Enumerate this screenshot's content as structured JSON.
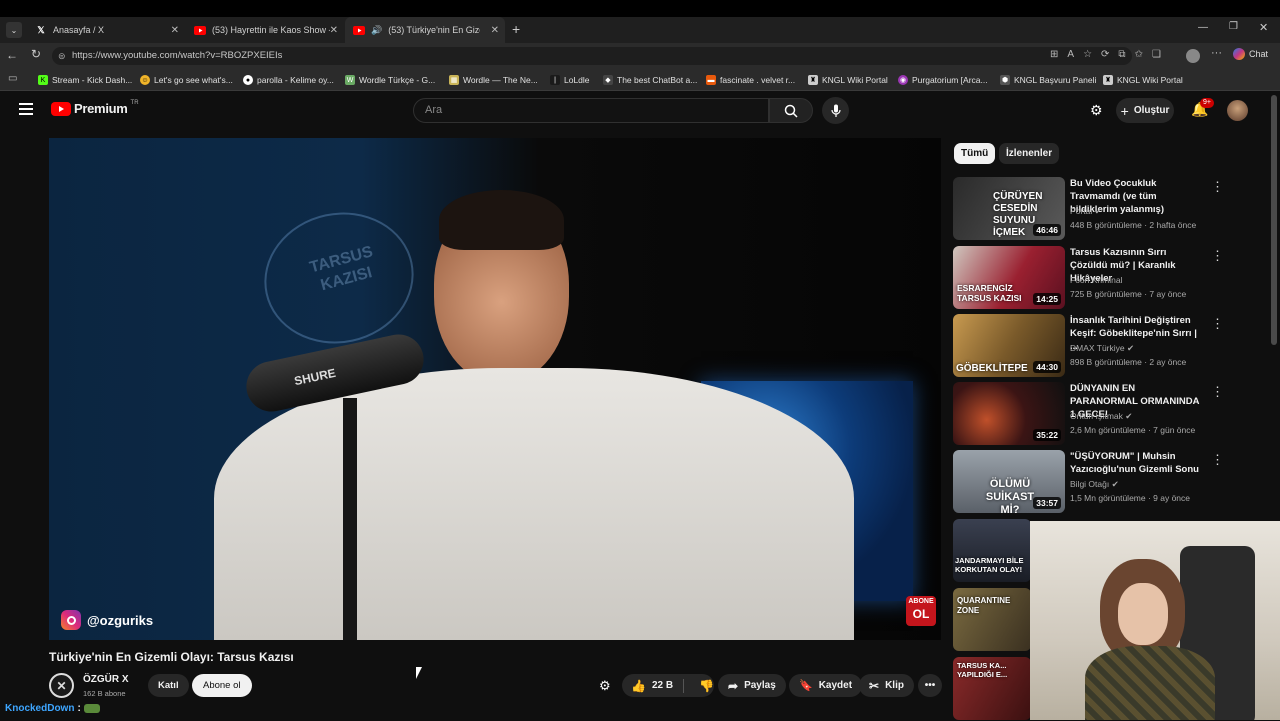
{
  "tabs": [
    {
      "title": "Anasayfa / X",
      "icon": "x-logo-icon"
    },
    {
      "title": "(53) Hayrettin ile Kaos Show - 2.S",
      "icon": "youtube-icon"
    },
    {
      "title": "(53) Türkiye'nin En Gizemli Ol",
      "icon": "youtube-icon",
      "active": true
    }
  ],
  "address": {
    "url": "https://www.youtube.com/watch?v=RBOZPXEIEIs"
  },
  "browser": {
    "chat_label": "Chat"
  },
  "bookmarks": [
    {
      "label": "Stream - Kick Dash...",
      "color": "#53fc18",
      "glyph": "K"
    },
    {
      "label": "Let's go see what's...",
      "color": "#f0b429",
      "glyph": "☺"
    },
    {
      "label": "parolla - Kelime oy...",
      "color": "#ffffff",
      "glyph": "●"
    },
    {
      "label": "Wordle Türkçe - G...",
      "color": "#6aaa64",
      "glyph": "W"
    },
    {
      "label": "Wordle — The Ne...",
      "color": "#c9b458",
      "glyph": "▦"
    },
    {
      "label": "LoLdle",
      "color": "#1a1a1a",
      "glyph": "|"
    },
    {
      "label": "The best ChatBot a...",
      "color": "#444444",
      "glyph": "◆"
    },
    {
      "label": "fascinate . velvet r...",
      "color": "#e8590c",
      "glyph": "▬"
    },
    {
      "label": "KNGL Wiki Portal",
      "color": "#cccccc",
      "glyph": "♜"
    },
    {
      "label": "Purgatorium [Arca...",
      "color": "#9c36b5",
      "glyph": "◉"
    },
    {
      "label": "KNGL Başvuru Paneli",
      "color": "#555555",
      "glyph": "⬢"
    },
    {
      "label": "KNGL Wiki Portal",
      "color": "#cccccc",
      "glyph": "♜"
    }
  ],
  "yt": {
    "logo_text": "Premium",
    "region": "TR",
    "search_placeholder": "Ara",
    "create_label": "Oluştur",
    "notif_count": "9+"
  },
  "video": {
    "watermark_handle": "@ozguriks",
    "mic_brand": "SHURE",
    "wall_text": "TARSUS KAZISI",
    "abone_badge_line1": "ABONE",
    "abone_badge_line2": "OL",
    "title": "Türkiye'nin En Gizemli Olayı: Tarsus Kazısı"
  },
  "channel": {
    "name": "ÖZGÜR X",
    "subs": "162 B abone",
    "join_label": "Katıl",
    "subscribe_label": "Abone ol"
  },
  "actions": {
    "likes": "22 B",
    "share": "Paylaş",
    "save": "Kaydet",
    "clip": "Klip"
  },
  "chips": [
    "Tümü",
    "İzlenenler"
  ],
  "sidebar": [
    {
      "title": "Bu Video Çocukluk Travmamdı (ve tüm bildiklerim yalanmış)",
      "channel": "Portal",
      "verified": true,
      "meta": "448 B görüntüleme · 2 hafta önce",
      "duration": "46:46",
      "thumb_text": "ÇÜRÜYEN CESEDİN SUYUNU İÇMEK",
      "thumb_bg": "#3a3a3a"
    },
    {
      "title": "Tarsus Kazısının Sırrı Çözüldü mü? | Karanlık Hikâyeler",
      "channel": "Foon Kriminal",
      "verified": false,
      "meta": "725 B görüntüleme · 7 ay önce",
      "duration": "14:25",
      "thumb_text": "ESRARENGİZ TARSUS KAZISI",
      "thumb_bg": "#8a1c2a"
    },
    {
      "title": "İnsanlık Tarihini Değiştiren Keşif: Göbeklitepe'nin Sırrı | ...",
      "channel": "DMAX Türkiye",
      "verified": true,
      "meta": "898 B görüntüleme · 2 ay önce",
      "duration": "44:30",
      "thumb_text": "GÖBEKLİTEPE",
      "thumb_bg": "#7a5a2a"
    },
    {
      "title": "DÜNYANIN EN PARANORMAL ORMANINDA 1 GECE!",
      "channel": "Orkun Işıtmak",
      "verified": true,
      "meta": "2,6 Mn görüntüleme · 7 gün önce",
      "duration": "35:22",
      "thumb_text": "",
      "thumb_bg": "#3b1414"
    },
    {
      "title": "\"ÜŞÜYORUM\" | Muhsin Yazıcıoğlu'nun Gizemli Sonu",
      "channel": "Bilgi Otağı",
      "verified": true,
      "meta": "1,5 Mn görüntüleme · 9 ay önce",
      "duration": "33:57",
      "thumb_text": "ÖLÜMÜ SUİKAST Mİ?",
      "thumb_bg": "#6a7078"
    },
    {
      "title": "",
      "channel": "",
      "verified": false,
      "meta": "",
      "duration": "",
      "thumb_text": "JANDARMAYI BİLE KORKUTAN OLAY!",
      "thumb_bg": "#2a2f3a"
    },
    {
      "title": "",
      "channel": "",
      "verified": false,
      "meta": "",
      "duration": "",
      "thumb_text": "QUARANTINE ZONE",
      "thumb_bg": "#4a4030"
    },
    {
      "title": "",
      "channel": "",
      "verified": false,
      "meta": "",
      "duration": "",
      "thumb_text": "TARSUS KA... YAPILDIĞI E...",
      "thumb_bg": "#5a1a1a"
    }
  ],
  "overlay": {
    "user": "KnockedDown",
    "sep": ":"
  },
  "colors": {
    "youtube_red": "#ff0000",
    "accent_blue": "#3ea6ff",
    "bg": "#0f0f0f"
  }
}
